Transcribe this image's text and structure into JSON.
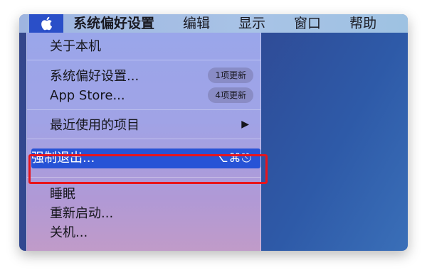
{
  "menubar": {
    "apple_icon": "apple-logo",
    "items": [
      {
        "label": "系统偏好设置"
      },
      {
        "label": "编辑"
      },
      {
        "label": "显示"
      },
      {
        "label": "窗口"
      },
      {
        "label": "帮助"
      }
    ]
  },
  "apple_menu": {
    "about": "关于本机",
    "system_prefs": "系统偏好设置...",
    "system_prefs_badge": "1项更新",
    "app_store": "App Store...",
    "app_store_badge": "4项更新",
    "recent_items": "最近使用的项目",
    "recent_items_arrow": "▶",
    "force_quit": "强制退出...",
    "force_quit_shortcut": "⌥⌘⎋",
    "sleep": "睡眠",
    "restart": "重新启动...",
    "shutdown": "关机..."
  },
  "colors": {
    "highlight": "#2753d6",
    "annotation_border": "#e8141c",
    "apple_button_bg": "#2a4fc8"
  }
}
